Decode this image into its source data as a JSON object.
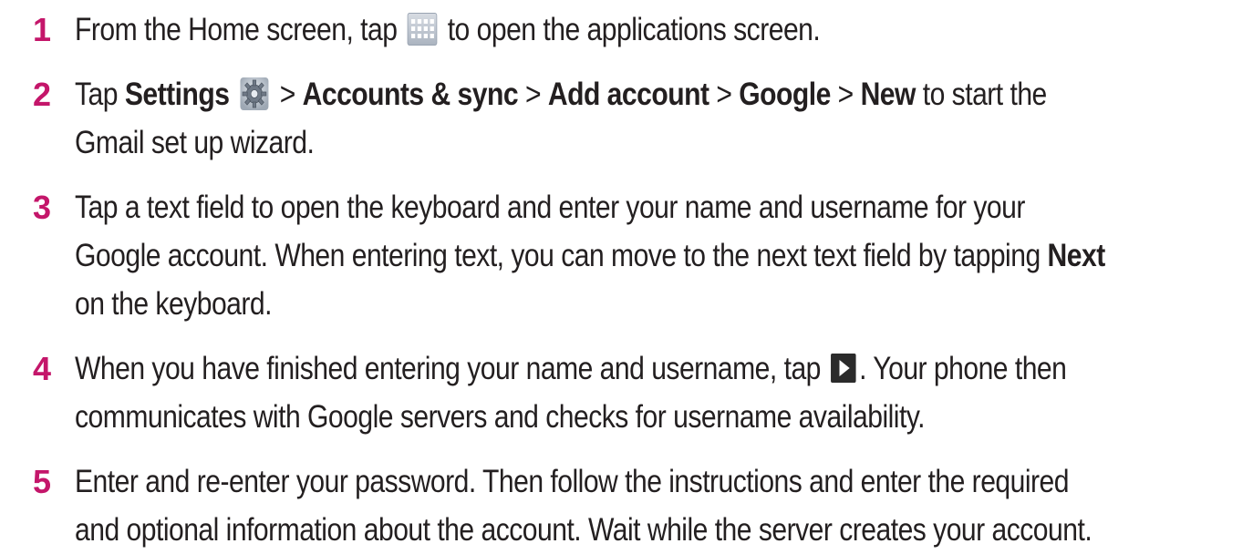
{
  "steps": [
    {
      "number": "1",
      "parts": {
        "a": "From the Home screen, tap",
        "b": "to open the applications screen."
      }
    },
    {
      "number": "2",
      "parts": {
        "tap": "Tap",
        "settings": "Settings",
        "gt1": ">",
        "accounts": "Accounts & sync",
        "gt2": ">",
        "add": "Add account",
        "gt3": ">",
        "google": "Google",
        "gt4": ">",
        "new": "New",
        "rest": "to start the",
        "line2": "Gmail set up wizard."
      }
    },
    {
      "number": "3",
      "parts": {
        "line1": "Tap a text field to open the keyboard and enter your name and username for your",
        "line2a": "Google account. When entering text, you can move to the next text field by tapping",
        "next": "Next",
        "line3": "on the keyboard."
      }
    },
    {
      "number": "4",
      "parts": {
        "line1a": "When you have finished entering your name and username, tap",
        "line1b": ". Your phone then",
        "line2": "communicates with Google servers and checks for username availability."
      }
    },
    {
      "number": "5",
      "parts": {
        "line1": "Enter and re-enter your password. Then follow the instructions and enter the required",
        "line2": "and optional information about the account. Wait while the server creates your account."
      }
    }
  ],
  "colors": {
    "step_number": "#c4166a",
    "text": "#231f20"
  },
  "icons": {
    "apps": "apps-grid-icon",
    "settings": "settings-gear-icon",
    "next": "next-arrow-icon"
  }
}
